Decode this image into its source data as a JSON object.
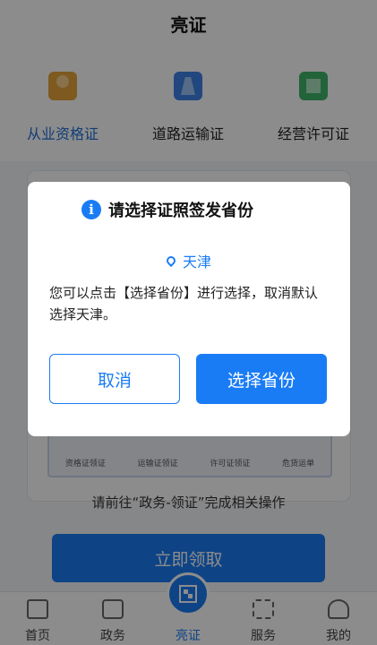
{
  "header": {
    "title": "亮证"
  },
  "categories": [
    {
      "label": "从业资格证",
      "icon": "person-certificate-icon"
    },
    {
      "label": "道路运输证",
      "icon": "road-icon"
    },
    {
      "label": "经营许可证",
      "icon": "license-icon"
    }
  ],
  "card": {
    "steps": [
      "资格证领证",
      "运输证领证",
      "许可证领证",
      "危货运单"
    ]
  },
  "hint": "请前往“政务-领证”完成相关操作",
  "claim_button": "立即领取",
  "tabs": [
    {
      "label": "首页",
      "icon": "home-icon"
    },
    {
      "label": "政务",
      "icon": "government-icon"
    },
    {
      "label": "亮证",
      "icon": "qr-code-icon"
    },
    {
      "label": "服务",
      "icon": "services-icon"
    },
    {
      "label": "我的",
      "icon": "profile-icon"
    }
  ],
  "dialog": {
    "title": "请选择证照签发省份",
    "location": "天津",
    "description": "您可以点击【选择省份】进行选择，取消默认选择天津。",
    "cancel_label": "取消",
    "select_label": "选择省份"
  },
  "colors": {
    "accent": "#1a7cf5",
    "overlay": "rgba(0,0,0,0.45)"
  }
}
